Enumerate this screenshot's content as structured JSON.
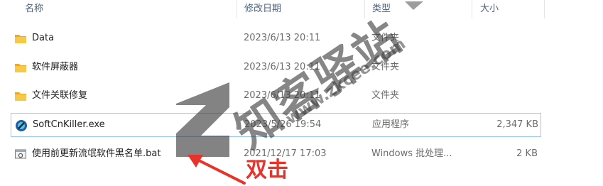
{
  "columns": {
    "name": "名称",
    "date": "修改日期",
    "type": "类型",
    "size": "大小"
  },
  "files": [
    {
      "name": "Data",
      "date": "2023/6/13 20:11",
      "type": "文件夹",
      "size": "",
      "icon": "folder-icon"
    },
    {
      "name": "软件屏蔽器",
      "date": "2023/6/13 20:11",
      "type": "文件夹",
      "size": "",
      "icon": "folder-icon"
    },
    {
      "name": "文件关联修复",
      "date": "2023/6/13 20:11",
      "type": "文件夹",
      "size": "",
      "icon": "folder-icon"
    },
    {
      "name": "SoftCnKiller.exe",
      "date": "2023/5/26 19:54",
      "type": "应用程序",
      "size": "2,347 KB",
      "icon": "app-icon",
      "selected": true
    },
    {
      "name": "使用前更新流氓软件黑名单.bat",
      "date": "2021/12/17 17:03",
      "type": "Windows 批处理...",
      "size": "2 KB",
      "icon": "batch-file-icon"
    }
  ],
  "watermark": {
    "title": "知客驿站",
    "url": "www.zkcee.com"
  },
  "annotation": {
    "text": "双击",
    "color": "#e8322a"
  },
  "colors": {
    "folder": "#f4c142",
    "selection_border": "#99c9ef",
    "header_text": "#4c607a"
  }
}
